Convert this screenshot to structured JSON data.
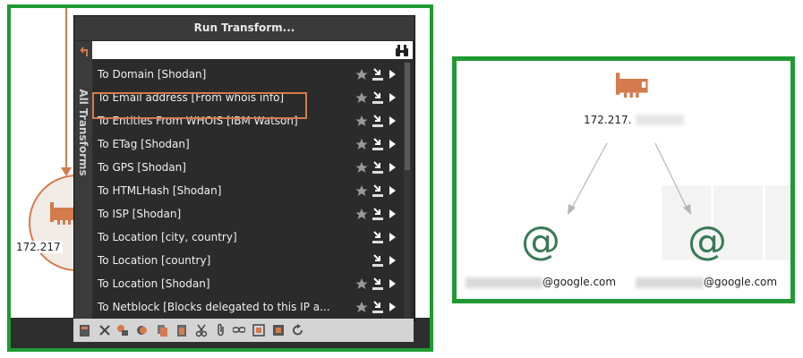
{
  "dialog": {
    "title": "Run Transform...",
    "search": {
      "value": "",
      "placeholder": ""
    },
    "side_tab": "All Transforms",
    "items": [
      {
        "label": "To Domain [Shodan]"
      },
      {
        "label": "To Email address [From whois info]"
      },
      {
        "label": "To Entities From WHOIS [IBM Watson]"
      },
      {
        "label": "To ETag [Shodan]"
      },
      {
        "label": "To GPS [Shodan]"
      },
      {
        "label": "To HTMLHash [Shodan]"
      },
      {
        "label": "To ISP [Shodan]"
      },
      {
        "label": "To Location [city, country]"
      },
      {
        "label": "To Location [country]"
      },
      {
        "label": "To Location [Shodan]"
      },
      {
        "label": "To Netblock [Blocks delegated to this IP a..."
      }
    ],
    "highlighted_index": 1
  },
  "left_graph": {
    "node_label": "172.217"
  },
  "right_graph": {
    "ip_label": "172.217.",
    "emails": [
      {
        "label": "@google.com"
      },
      {
        "label": "@google.com"
      }
    ],
    "at_symbol": "@"
  },
  "colors": {
    "frame_green": "#1f9a33",
    "highlight_orange": "#d47b4e",
    "dialog_bg": "#2b2b2b",
    "email_icon": "#3b7a57"
  },
  "icons": {
    "row": [
      "star-icon",
      "download-icon",
      "play-icon"
    ],
    "toolbar": [
      "export-icon",
      "delete-icon",
      "link-icon",
      "layers-icon",
      "copy-icon",
      "paste-icon",
      "cut-icon",
      "attach-icon",
      "chain-icon",
      "select-icon",
      "focus-icon",
      "refresh-icon"
    ]
  }
}
